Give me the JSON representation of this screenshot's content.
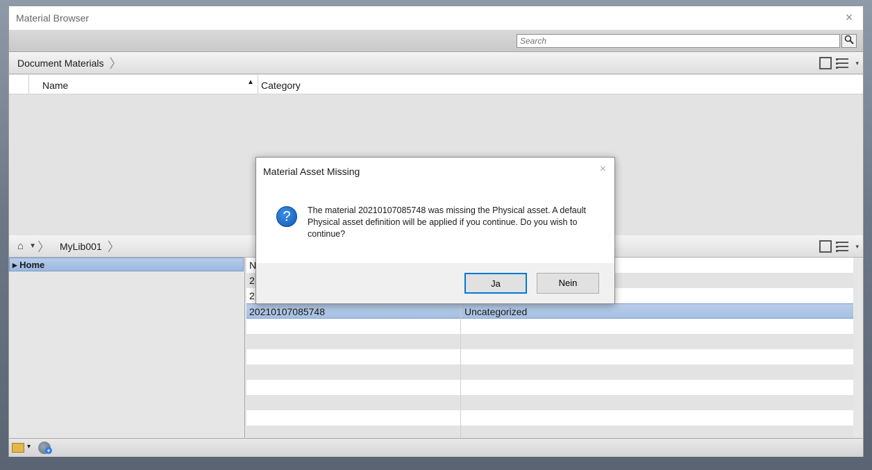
{
  "window": {
    "title": "Material Browser",
    "close_glyph": "×"
  },
  "search": {
    "placeholder": "Search",
    "icon": "search-icon"
  },
  "document_materials": {
    "breadcrumb": "Document Materials",
    "columns": {
      "name": "Name",
      "category": "Category"
    }
  },
  "library": {
    "breadcrumb": "MyLib001",
    "tree": {
      "home": "Home"
    },
    "rows": [
      {
        "name": "N",
        "category": ""
      },
      {
        "name": "2",
        "category": ""
      },
      {
        "name": "2",
        "category": ""
      },
      {
        "name": "20210107085748",
        "category": "Uncategorized"
      },
      {
        "name": "",
        "category": ""
      },
      {
        "name": "",
        "category": ""
      },
      {
        "name": "",
        "category": ""
      },
      {
        "name": "",
        "category": ""
      },
      {
        "name": "",
        "category": ""
      },
      {
        "name": "",
        "category": ""
      },
      {
        "name": "",
        "category": ""
      },
      {
        "name": "",
        "category": ""
      }
    ]
  },
  "dialog": {
    "title": "Material Asset Missing",
    "close_glyph": "×",
    "icon": "question-icon",
    "message": "The material 20210107085748 was missing the Physical asset.  A default Physical asset definition will be applied if you continue. Do you wish to continue?",
    "yes_label": "Ja",
    "no_label": "Nein"
  },
  "colors": {
    "accent": "#0078d7",
    "selection": "#a7c0e3"
  }
}
